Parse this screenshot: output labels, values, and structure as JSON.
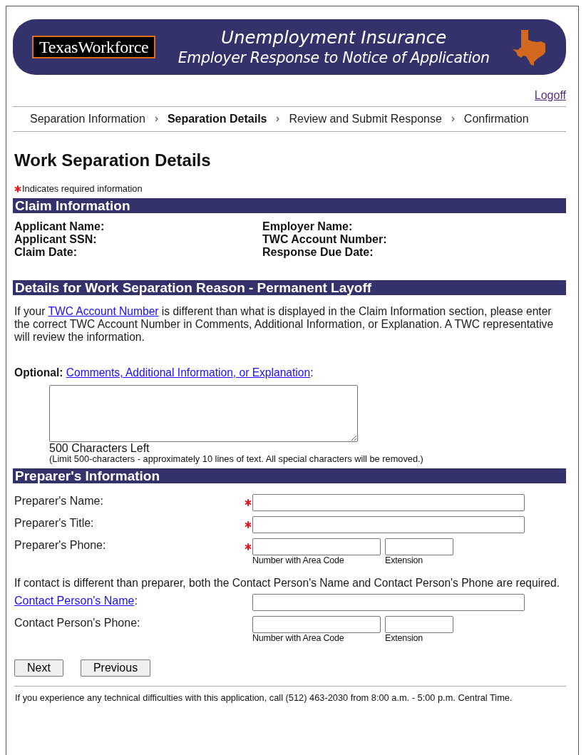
{
  "header": {
    "logo": "TexasWorkforce",
    "title": "Unemployment Insurance",
    "subtitle": "Employer Response to Notice of Application"
  },
  "logoff": "Logoff",
  "steps": [
    {
      "label": "Separation Information",
      "selected": false
    },
    {
      "label": "Separation Details",
      "selected": true
    },
    {
      "label": "Review and Submit Response",
      "selected": false
    },
    {
      "label": "Confirmation",
      "selected": false
    }
  ],
  "page_title": "Work Separation Details",
  "required_note": "Indicates required information",
  "claim_information": {
    "title": "Claim Information",
    "left": [
      "Applicant Name:",
      "Applicant SSN:",
      "Claim Date:"
    ],
    "right": [
      "Employer Name:",
      "TWC Account Number:",
      "Response Due Date:"
    ]
  },
  "details": {
    "title": "Details for Work Separation Reason - Permanent Layoff",
    "paragraph": {
      "before": "If your ",
      "link": "TWC Account Number",
      "after": " is different than what is displayed in the Claim Information section, please enter the correct TWC Account Number in Comments, Additional Information, or Explanation. A TWC representative will review the information."
    },
    "optional": {
      "label": "Optional:",
      "link": "Comments, Additional Information, or Explanation",
      "suffix": ":"
    },
    "counter": "500 Characters Left",
    "limit_note": "(Limit 500-characters - approximately 10 lines of text. All special characters will be removed.)"
  },
  "preparer": {
    "title": "Preparer's Information",
    "fields": [
      {
        "kind": "text",
        "label": "Preparer's Name:",
        "required": true
      },
      {
        "kind": "text",
        "label": "Preparer's Title:",
        "required": true
      },
      {
        "kind": "phone",
        "label": "Preparer's Phone:",
        "required": true,
        "number_hint": "Number with Area Code",
        "extension_hint": "Extension"
      }
    ],
    "contact_note": "If contact is different than preparer, both the Contact Person's Name and Contact Person's Phone are required.",
    "contact_fields": [
      {
        "kind": "text",
        "link": "Contact Person's Name",
        "label": ":",
        "required": false
      },
      {
        "kind": "phone",
        "label": "Contact Person's Phone:",
        "required": false,
        "number_hint": "Number with Area Code",
        "extension_hint": "Extension"
      }
    ]
  },
  "buttons": [
    "Next",
    "Previous"
  ],
  "footer": "If you experience any technical difficulties with this application, call (512) 463-2030 from 8:00 a.m. - 5:00 p.m. Central Time."
}
